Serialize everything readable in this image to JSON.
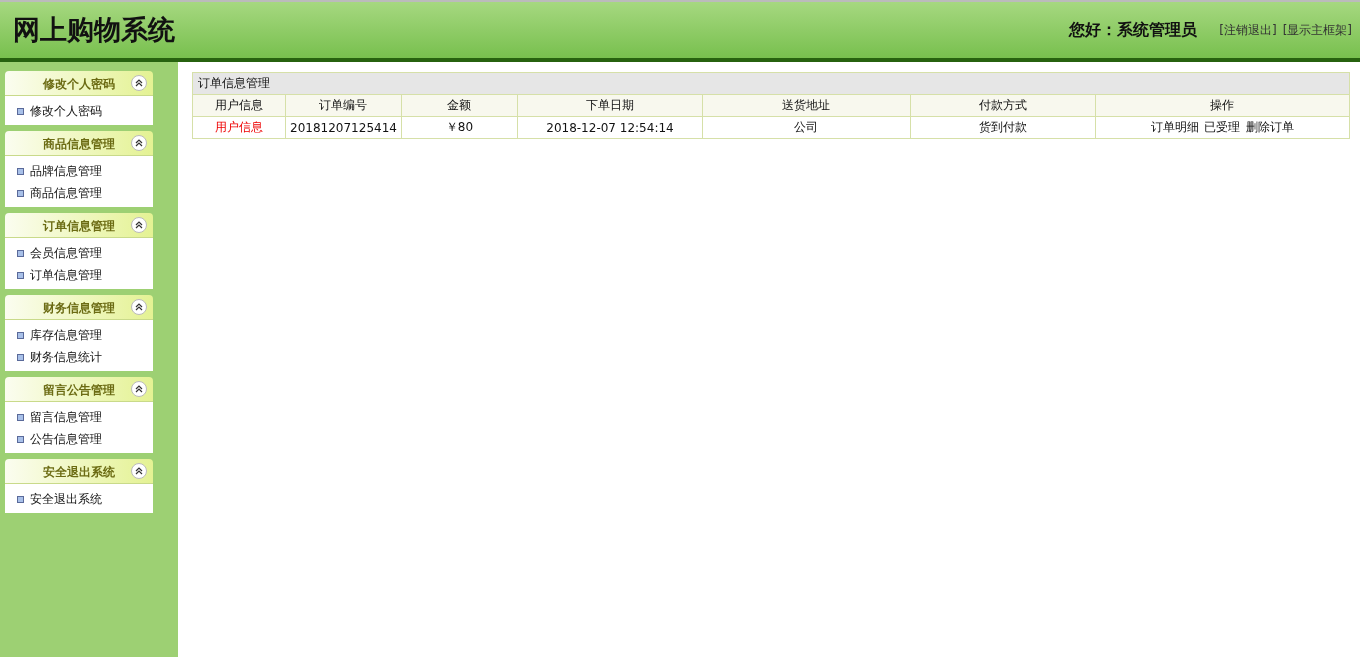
{
  "header": {
    "title": "网上购物系统",
    "greeting": "您好：系统管理员",
    "links": [
      "[注销退出]",
      "[显示主框架]"
    ]
  },
  "sidebar": {
    "groups": [
      {
        "title": "修改个人密码",
        "expanded": true,
        "items": [
          "修改个人密码"
        ]
      },
      {
        "title": "商品信息管理",
        "expanded": true,
        "items": [
          "品牌信息管理",
          "商品信息管理"
        ]
      },
      {
        "title": "订单信息管理",
        "expanded": true,
        "items": [
          "会员信息管理",
          "订单信息管理"
        ]
      },
      {
        "title": "财务信息管理",
        "expanded": true,
        "items": [
          "库存信息管理",
          "财务信息统计"
        ]
      },
      {
        "title": "留言公告管理",
        "expanded": true,
        "items": [
          "留言信息管理",
          "公告信息管理"
        ]
      },
      {
        "title": "安全退出系统",
        "expanded": true,
        "items": [
          "安全退出系统"
        ]
      }
    ]
  },
  "table": {
    "title": "订单信息管理",
    "columns": [
      "用户信息",
      "订单编号",
      "金额",
      "下单日期",
      "送货地址",
      "付款方式",
      "操作"
    ],
    "rows": [
      {
        "user_link": "用户信息",
        "order_no": "20181207125414",
        "amount": "￥80",
        "date": "2018-12-07 12:54:14",
        "address": "公司",
        "payment": "货到付款",
        "actions": [
          "订单明细",
          "已受理",
          "删除订单"
        ]
      }
    ]
  }
}
